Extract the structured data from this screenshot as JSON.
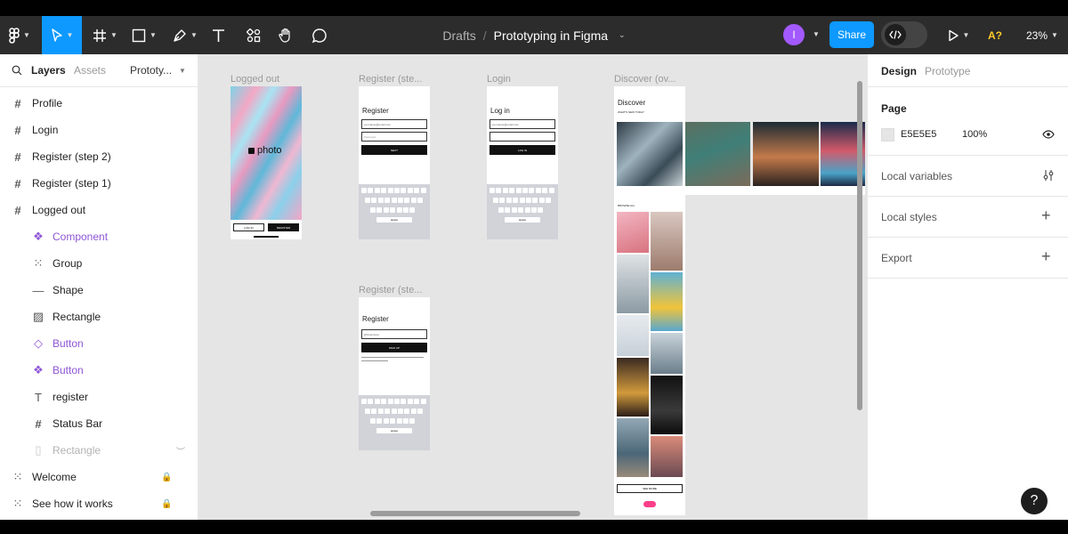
{
  "toolbar": {
    "breadcrumb_parent": "Drafts",
    "breadcrumb_sep": "/",
    "file_name": "Prototyping in Figma",
    "avatar_initial": "I",
    "share_label": "Share",
    "a_label": "A?",
    "zoom": "23%",
    "accent": "#0d99ff"
  },
  "left_panel": {
    "tabs": {
      "layers": "Layers",
      "assets": "Assets",
      "page": "Prototy..."
    },
    "layers": [
      {
        "label": "Profile",
        "icon": "frame-icon",
        "level": 0
      },
      {
        "label": "Login",
        "icon": "frame-icon",
        "level": 0
      },
      {
        "label": "Register (step 2)",
        "icon": "frame-icon",
        "level": 0
      },
      {
        "label": "Register (step 1)",
        "icon": "frame-icon",
        "level": 0
      },
      {
        "label": "Logged out",
        "icon": "frame-icon",
        "level": 0
      },
      {
        "label": "Component",
        "icon": "component-icon",
        "level": 1
      },
      {
        "label": "Group",
        "icon": "group-icon",
        "level": 1
      },
      {
        "label": "Shape",
        "icon": "line-icon",
        "level": 1
      },
      {
        "label": "Rectangle",
        "icon": "image-icon",
        "level": 1
      },
      {
        "label": "Button",
        "icon": "instance-icon",
        "level": 1
      },
      {
        "label": "Button",
        "icon": "component-icon",
        "level": 1
      },
      {
        "label": "register",
        "icon": "text-icon",
        "level": 1
      },
      {
        "label": "Status Bar",
        "icon": "frame-icon",
        "level": 1
      },
      {
        "label": "Rectangle",
        "icon": "rectangle-icon",
        "level": 1
      },
      {
        "label": "Welcome",
        "icon": "section-icon",
        "level": 0
      },
      {
        "label": "See how it works",
        "icon": "section-icon",
        "level": 0
      }
    ]
  },
  "canvas": {
    "frames": [
      {
        "label": "Logged out"
      },
      {
        "label": "Register (ste..."
      },
      {
        "label": "Login"
      },
      {
        "label": "Discover (ov..."
      },
      {
        "label": "Register (ste..."
      }
    ],
    "logged_out": {
      "brand": "photo",
      "btn1": "LOG IN",
      "btn2": "REGISTER"
    },
    "register1": {
      "title": "Register",
      "field1": "yourname@email.com",
      "field2": "Password",
      "button": "NEXT",
      "keyboard": "space"
    },
    "login": {
      "title": "Log in",
      "field1": "yourname@email.com",
      "button": "LOG IN",
      "keyboard": "space"
    },
    "register2": {
      "title": "Register",
      "field1": "@Username",
      "button": "SIGN UP",
      "keyboard": "space"
    },
    "discover": {
      "title": "Discover",
      "section1": "WHAT'S NEW TODAY",
      "section2": "BROWSE ALL",
      "more": "SEE MORE"
    }
  },
  "right_panel": {
    "tabs": {
      "design": "Design",
      "prototype": "Prototype"
    },
    "page_heading": "Page",
    "page_color": "E5E5E5",
    "page_opacity": "100%",
    "local_variables": "Local variables",
    "local_styles": "Local styles",
    "export": "Export",
    "help": "?"
  }
}
